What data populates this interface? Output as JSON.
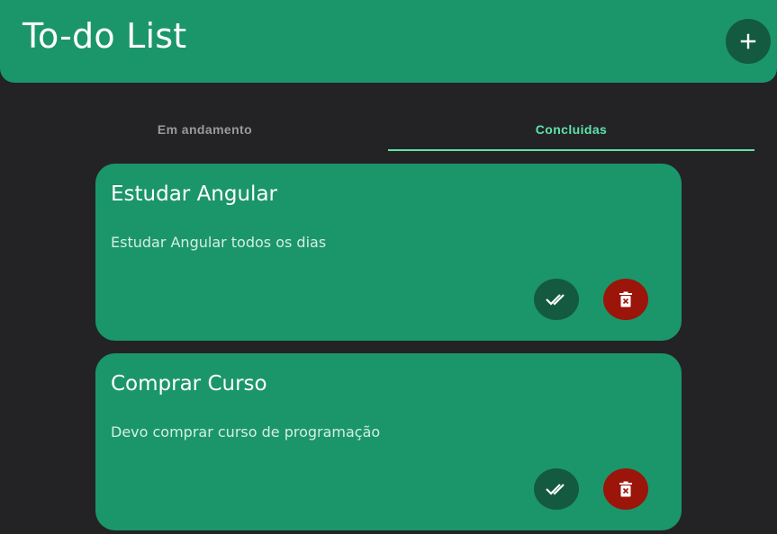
{
  "header": {
    "title": "To-do List",
    "add_icon": "plus-icon"
  },
  "tabs": [
    {
      "label": "Em andamento",
      "active": false
    },
    {
      "label": "Concluidas",
      "active": true
    }
  ],
  "tasks": [
    {
      "title": "Estudar Angular",
      "description": "Estudar Angular todos os dias",
      "done_icon": "double-check-icon",
      "delete_icon": "trash-icon"
    },
    {
      "title": "Comprar Curso",
      "description": "Devo comprar curso de programação",
      "done_icon": "double-check-icon",
      "delete_icon": "trash-icon"
    }
  ],
  "colors": {
    "primary": "#1b966a",
    "primary_dark": "#135a40",
    "accent": "#5fe3a8",
    "danger": "#9b150b",
    "background": "#232326"
  }
}
